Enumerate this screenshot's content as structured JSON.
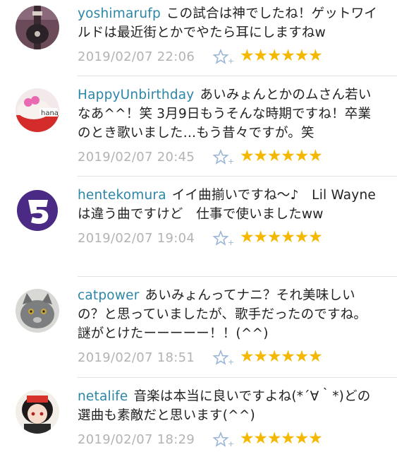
{
  "comments": [
    {
      "user": "yoshimarufp",
      "text": "この試合は神でしたね！ゲットワイルドは最近街とかでやたら耳にしますねw",
      "date": "2019/02/07 22:06",
      "stars": "★★★★★★"
    },
    {
      "user": "HappyUnbirthday",
      "text": "あいみょんとかのムさん若いなあ^^！笑 3月9日もうそんな時期ですね！卒業のとき歌いました…もう昔々ですが。笑",
      "date": "2019/02/07 20:45",
      "stars": "★★★★★★"
    },
    {
      "user": "hentekomura",
      "text": "イイ曲揃いですね〜♪　Lil Wayneは違う曲ですけど　仕事で使いましたww",
      "date": "2019/02/07 19:04",
      "stars": "★★★★★★"
    },
    {
      "user": "catpower",
      "text": "あいみょんってナニ？それ美味しいの？と思っていましたが、歌手だったのですね。謎がとけたーーーーー！！(^^)",
      "date": "2019/02/07 18:51",
      "stars": "★★★★★★"
    },
    {
      "user": "netalife",
      "text": "音楽は本当に良いですよね(*´∀｀*)どの選曲も素敵だと思います(^^)",
      "date": "2019/02/07 18:29",
      "stars": "★★★★★★"
    }
  ],
  "avatar_labels": {
    "happy": "hana"
  },
  "colors": {
    "username": "#2c86a8",
    "star": "#f5b800",
    "date": "#b3b3b3",
    "fav_icon": "#9ab6d6"
  }
}
